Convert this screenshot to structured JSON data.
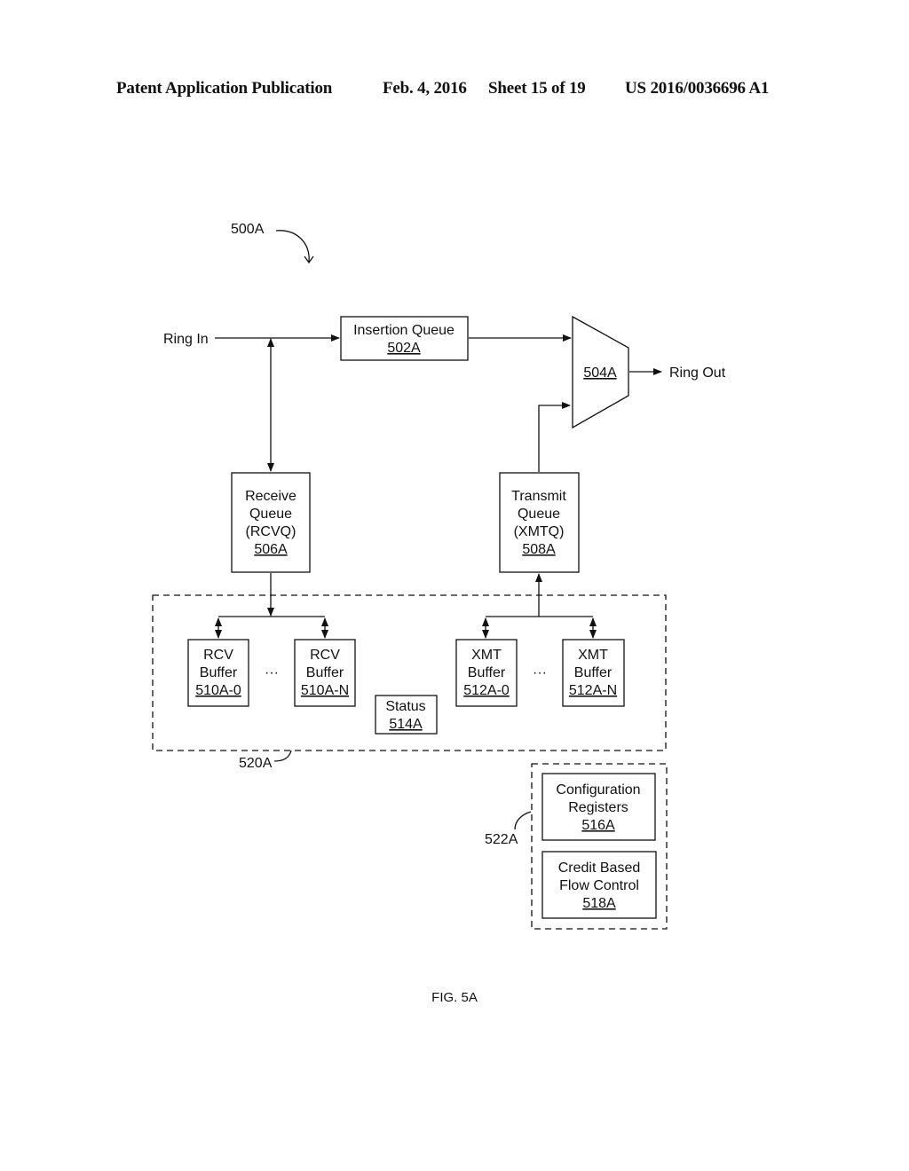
{
  "header": {
    "publication": "Patent Application Publication",
    "date": "Feb. 4, 2016",
    "sheet": "Sheet 15 of 19",
    "number": "US 2016/0036696 A1"
  },
  "figure": {
    "ref": "500A",
    "caption": "FIG. 5A",
    "ring_in": "Ring In",
    "ring_out": "Ring Out",
    "insertion_queue": {
      "label": "Insertion Queue",
      "ref": "502A"
    },
    "mux": {
      "ref": "504A"
    },
    "receive_queue": {
      "lines": [
        "Receive",
        "Queue",
        "(RCVQ)"
      ],
      "ref": "506A"
    },
    "transmit_queue": {
      "lines": [
        "Transmit",
        "Queue",
        "(XMTQ)"
      ],
      "ref": "508A"
    },
    "rcv_buffers": [
      {
        "lines": [
          "RCV",
          "Buffer"
        ],
        "ref": "510A-0"
      },
      {
        "lines": [
          "RCV",
          "Buffer"
        ],
        "ref": "510A-N"
      }
    ],
    "xmt_buffers": [
      {
        "lines": [
          "XMT",
          "Buffer"
        ],
        "ref": "512A-0"
      },
      {
        "lines": [
          "XMT",
          "Buffer"
        ],
        "ref": "512A-N"
      }
    ],
    "ellipsis": "···",
    "status": {
      "label": "Status",
      "ref": "514A"
    },
    "buffer_group_ref": "520A",
    "config_group_ref": "522A",
    "config_registers": {
      "lines": [
        "Configuration",
        "Registers"
      ],
      "ref": "516A"
    },
    "flow_control": {
      "lines": [
        "Credit Based",
        "Flow Control"
      ],
      "ref": "518A"
    }
  }
}
